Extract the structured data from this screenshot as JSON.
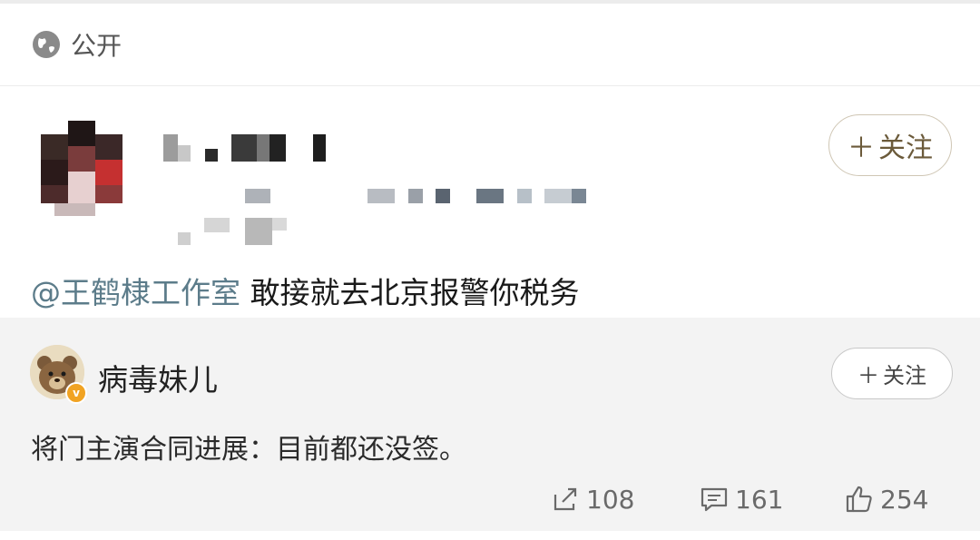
{
  "visibility": {
    "label": "公开",
    "icon": "globe-icon"
  },
  "post": {
    "follow_label": "关注",
    "mention": "@王鹤棣工作室",
    "text": " 敢接就去北京报警你税务"
  },
  "repost": {
    "username": "病毒妹儿",
    "badge": "v",
    "follow_label": "关注",
    "text": "将门主演合同进展：目前都还没签。",
    "stats": {
      "reposts": "108",
      "comments": "161",
      "likes": "254"
    }
  },
  "colors": {
    "mention": "#5c7c8a",
    "follow_border": "#cfc6b4",
    "vip_badge": "#f1a322",
    "card_bg": "#f3f3f3"
  }
}
